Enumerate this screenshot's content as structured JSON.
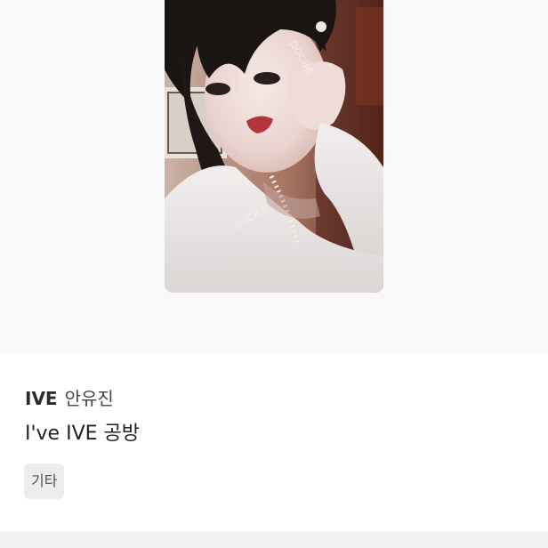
{
  "product": {
    "group": "IVE",
    "member": "안유진",
    "title": "I've IVE 공방",
    "tag": "기타"
  },
  "image": {
    "watermark": "pocaa"
  }
}
